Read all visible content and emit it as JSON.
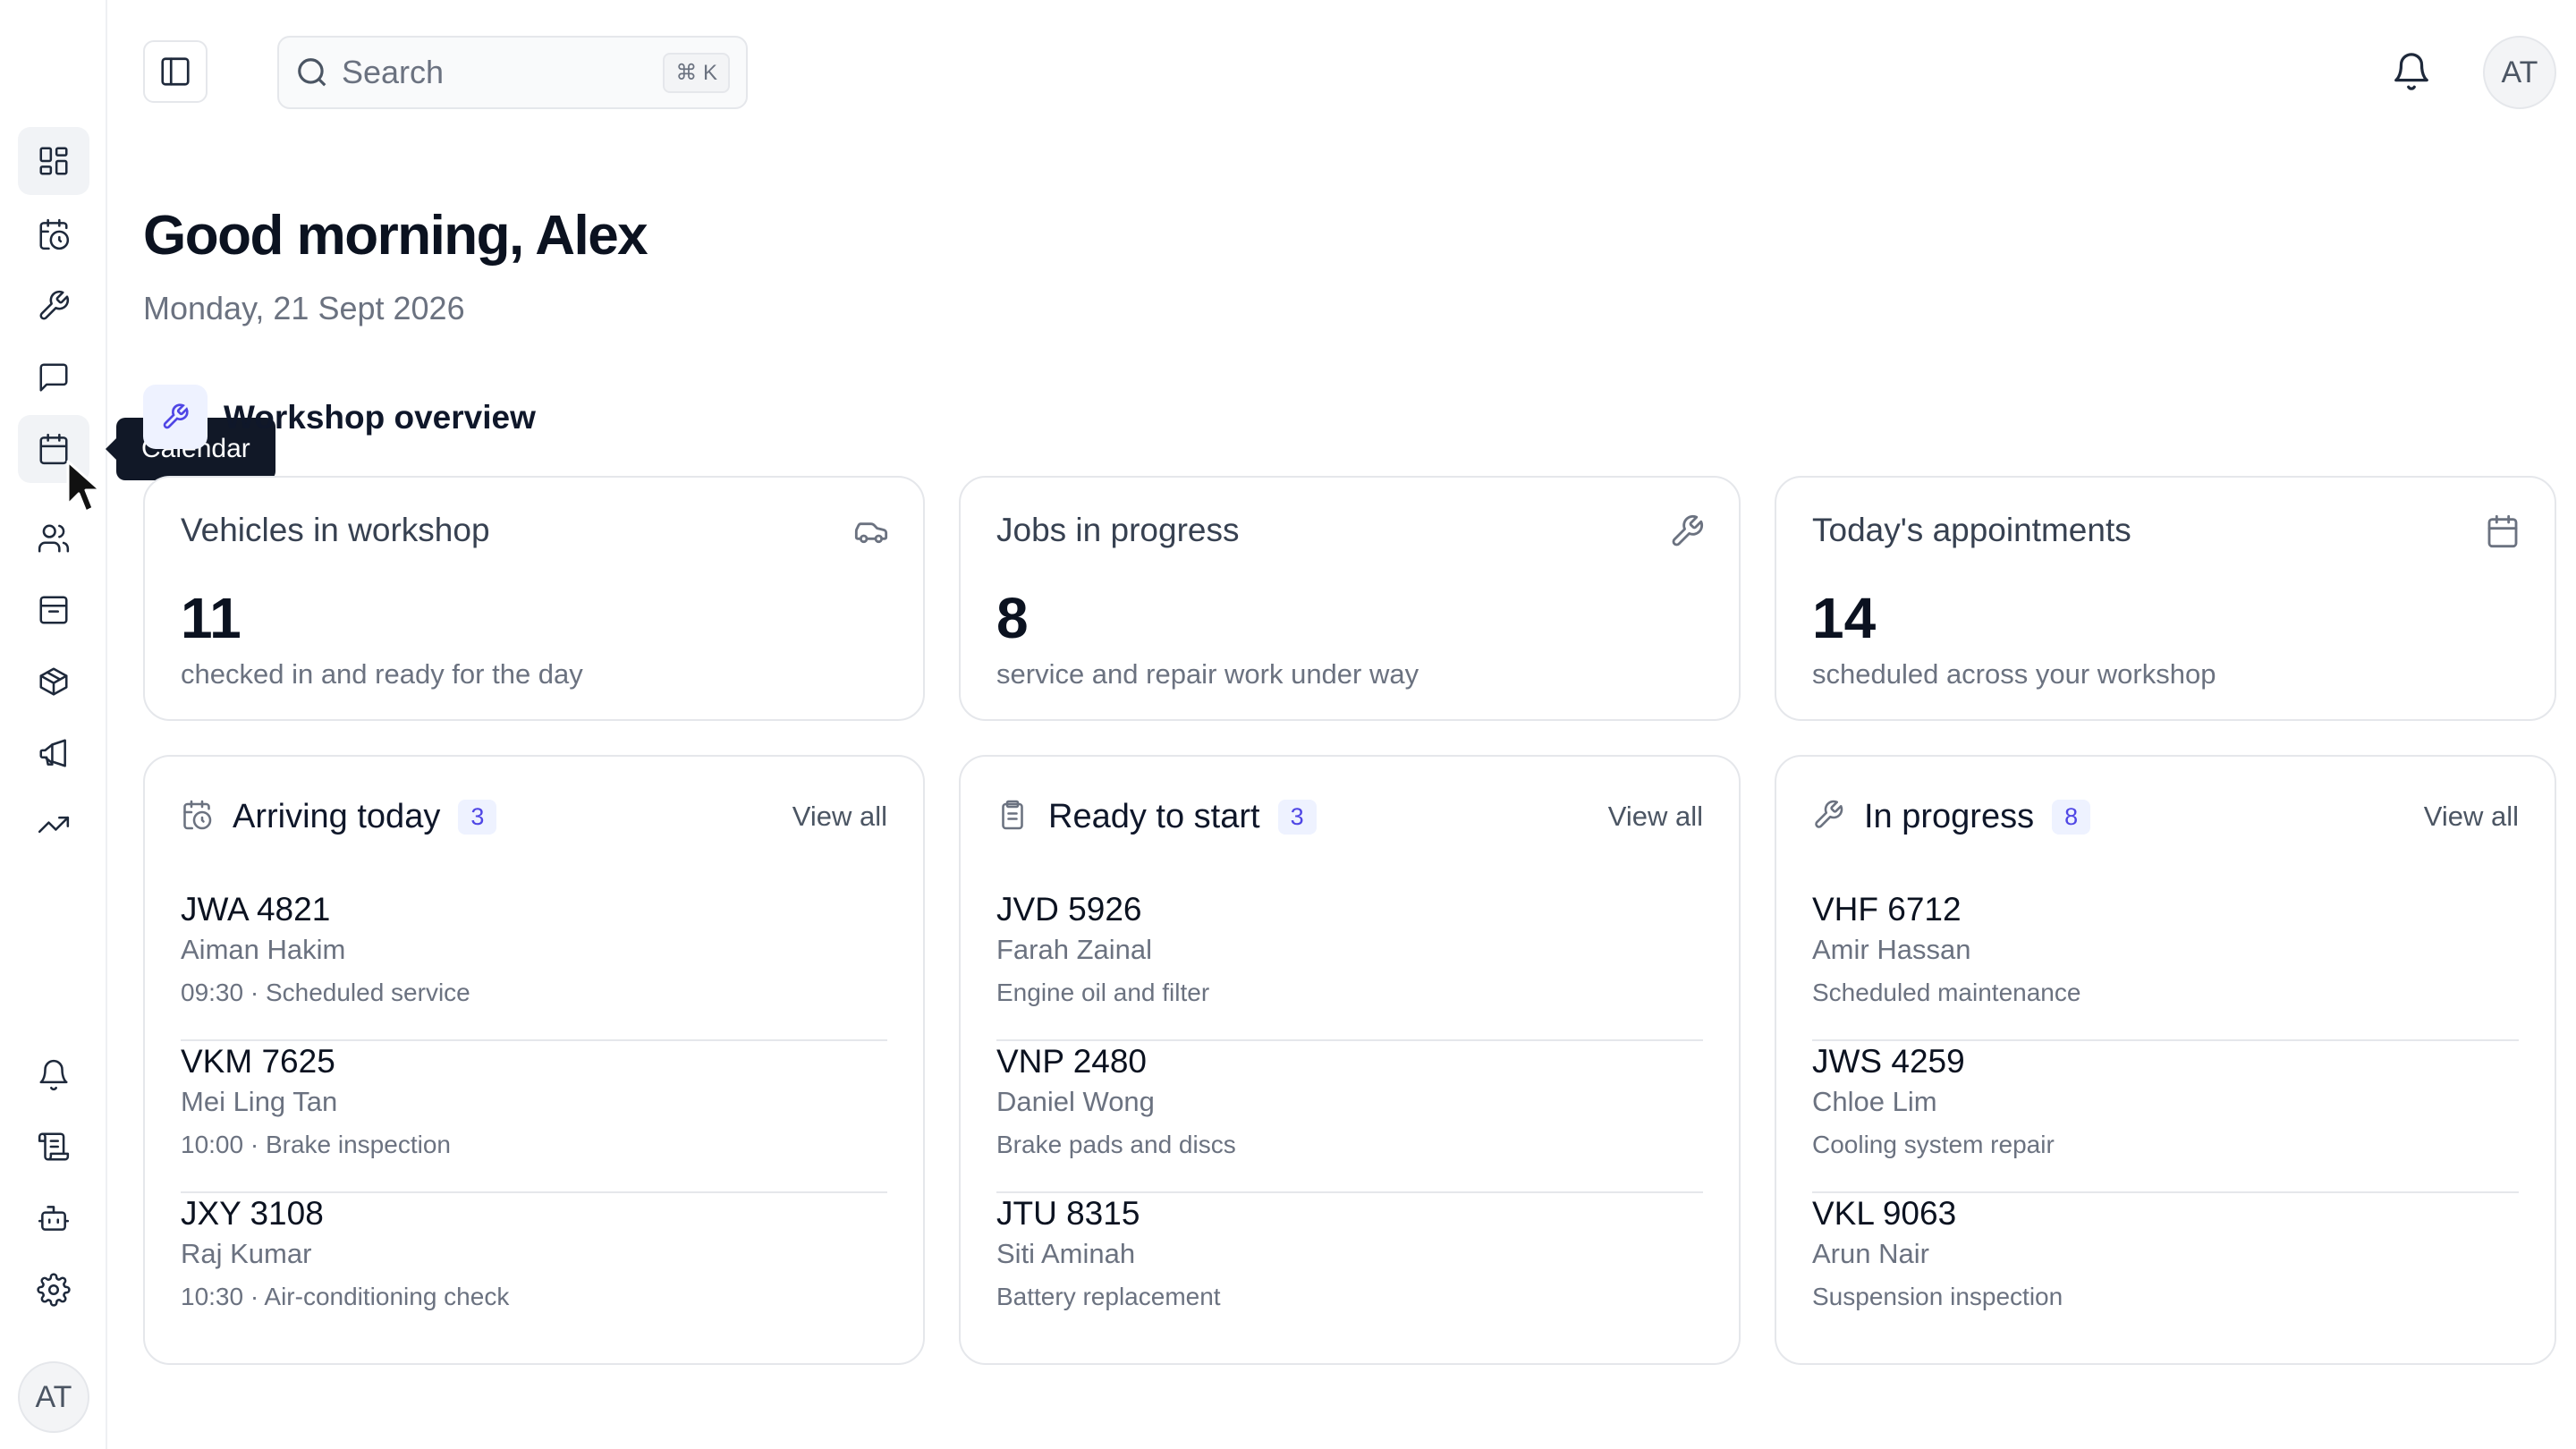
{
  "sidebar": {
    "nav": [
      {
        "icon": "dashboard-icon",
        "active": true
      },
      {
        "icon": "calendar-clock-icon"
      },
      {
        "icon": "wrench-icon"
      },
      {
        "icon": "message-icon"
      },
      {
        "icon": "calendar-icon",
        "hover": true
      },
      {
        "icon": "users-icon"
      },
      {
        "icon": "inbox-icon"
      },
      {
        "icon": "package-icon"
      },
      {
        "icon": "megaphone-icon"
      },
      {
        "icon": "trending-up-icon"
      }
    ],
    "bottom": [
      {
        "icon": "bell-icon"
      },
      {
        "icon": "scroll-icon"
      },
      {
        "icon": "bot-icon"
      },
      {
        "icon": "settings-icon"
      }
    ],
    "avatar_initials": "AT",
    "tooltip": "Calendar"
  },
  "header": {
    "search_placeholder": "Search",
    "search_shortcut": "⌘ K",
    "avatar_initials": "AT"
  },
  "main": {
    "greeting": "Good morning, Alex",
    "date": "Monday, 21 Sept 2026",
    "section_title": "Workshop overview",
    "stats": [
      {
        "label": "Vehicles in workshop",
        "icon": "car-icon",
        "value": "11",
        "sub": "checked in and ready for the day"
      },
      {
        "label": "Jobs in progress",
        "icon": "wrench-icon",
        "value": "8",
        "sub": "service and repair work under way"
      },
      {
        "label": "Today's appointments",
        "icon": "calendar-icon",
        "value": "14",
        "sub": "scheduled across your workshop"
      }
    ],
    "lists": [
      {
        "title": "Arriving today",
        "icon": "calendar-clock-icon",
        "count": "3",
        "view_all": "View all",
        "rows": [
          {
            "plate": "JWA 4821",
            "person": "Aiman Hakim",
            "detail": "09:30 · Scheduled service"
          },
          {
            "plate": "VKM 7625",
            "person": "Mei Ling Tan",
            "detail": "10:00 · Brake inspection"
          },
          {
            "plate": "JXY 3108",
            "person": "Raj Kumar",
            "detail": "10:30 · Air-conditioning check"
          }
        ]
      },
      {
        "title": "Ready to start",
        "icon": "clipboard-icon",
        "count": "3",
        "view_all": "View all",
        "rows": [
          {
            "plate": "JVD 5926",
            "person": "Farah Zainal",
            "detail": "Engine oil and filter"
          },
          {
            "plate": "VNP 2480",
            "person": "Daniel Wong",
            "detail": "Brake pads and discs"
          },
          {
            "plate": "JTU 8315",
            "person": "Siti Aminah",
            "detail": "Battery replacement"
          }
        ]
      },
      {
        "title": "In progress",
        "icon": "wrench-icon",
        "count": "8",
        "view_all": "View all",
        "rows": [
          {
            "plate": "VHF 6712",
            "person": "Amir Hassan",
            "detail": "Scheduled maintenance"
          },
          {
            "plate": "JWS 4259",
            "person": "Chloe Lim",
            "detail": "Cooling system repair"
          },
          {
            "plate": "VKL 9063",
            "person": "Arun Nair",
            "detail": "Suspension inspection"
          }
        ]
      }
    ]
  }
}
